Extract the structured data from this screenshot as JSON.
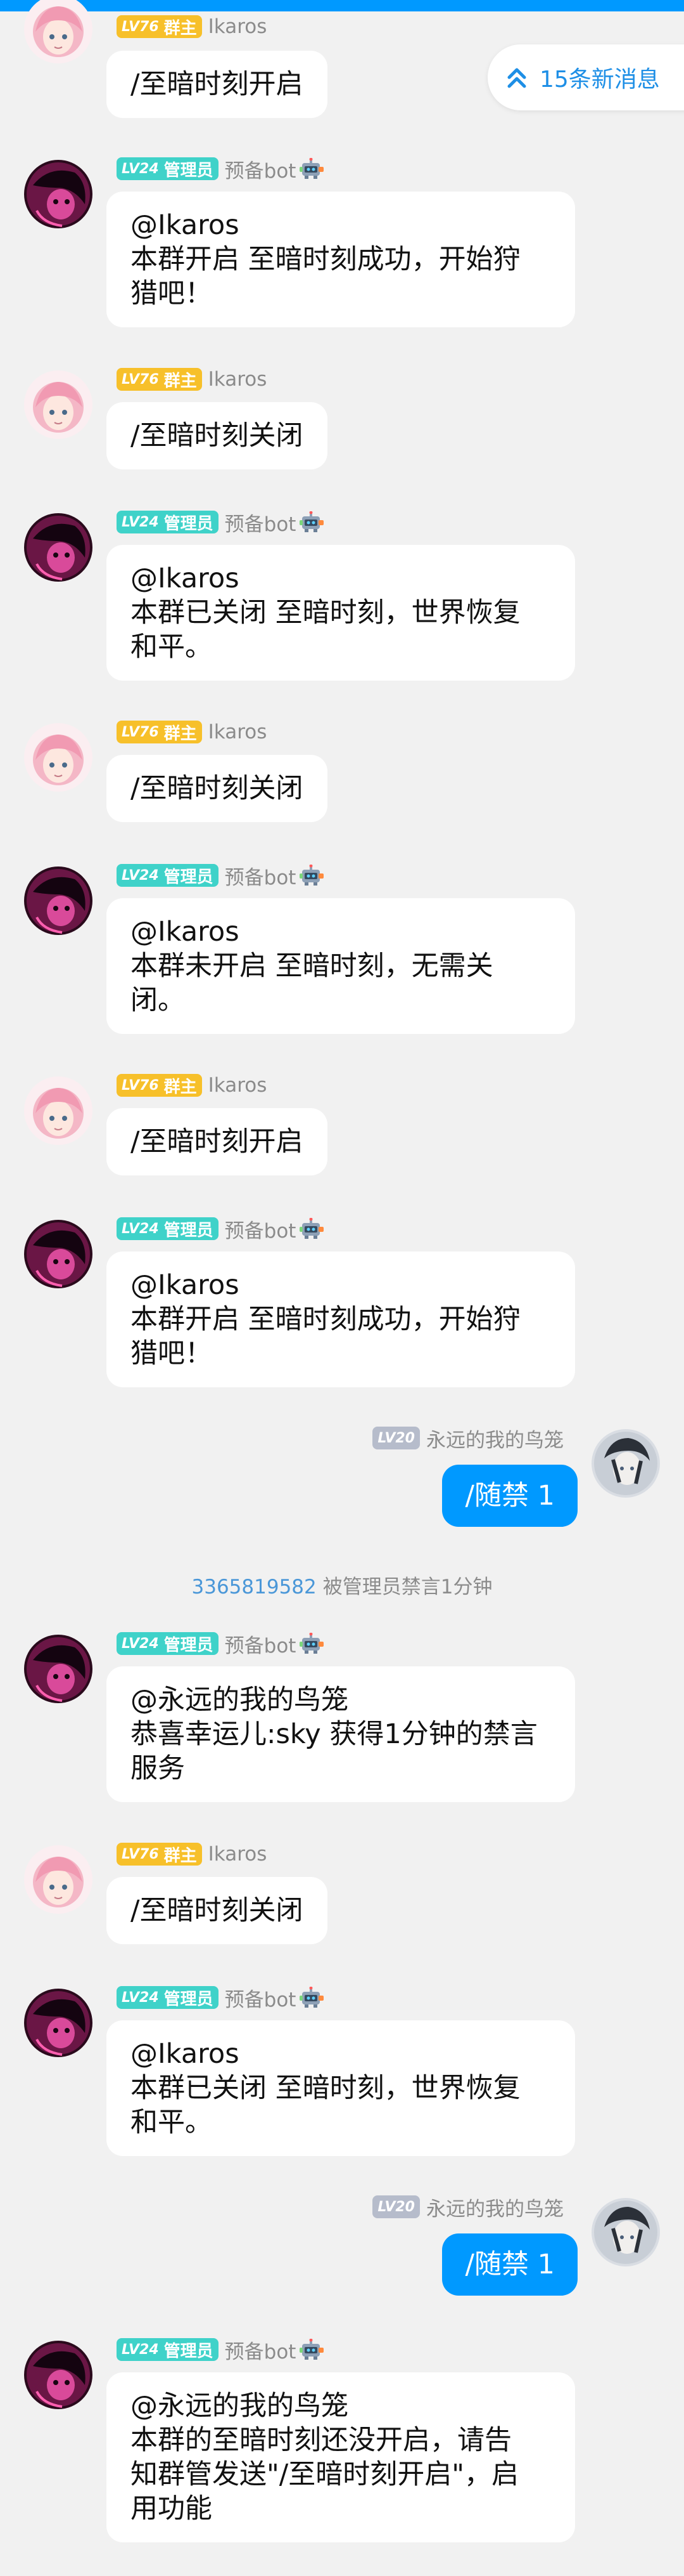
{
  "colors": {
    "accent": "#0099ff",
    "owner_badge": "#f7c02a",
    "admin_badge": "#3fd2c9",
    "member_badge": "#b6bccb",
    "link": "#4a97d8"
  },
  "new_messages": {
    "label": "15条新消息",
    "icon": "double-chevron-up-icon"
  },
  "roles": {
    "owner": {
      "level": "LV76",
      "role": "群主",
      "nick": "Ikaros"
    },
    "admin": {
      "level": "LV24",
      "role": "管理员",
      "nick": "预备bot",
      "icon": "robot-icon"
    },
    "member": {
      "level": "LV20",
      "nick": "永远的我的鸟笼"
    }
  },
  "messages": [
    {
      "lines": [
        "/至暗时刻开启"
      ]
    },
    {
      "lines": [
        "@Ikaros",
        "本群开启 至暗时刻成功，开始狩",
        "猎吧！"
      ]
    },
    {
      "lines": [
        "/至暗时刻关闭"
      ]
    },
    {
      "lines": [
        "@Ikaros",
        "本群已关闭 至暗时刻，世界恢复",
        "和平。"
      ]
    },
    {
      "lines": [
        "/至暗时刻关闭"
      ]
    },
    {
      "lines": [
        "@Ikaros",
        "本群未开启 至暗时刻，无需关",
        "闭。"
      ]
    },
    {
      "lines": [
        "/至暗时刻开启"
      ]
    },
    {
      "lines": [
        "@Ikaros",
        "本群开启 至暗时刻成功，开始狩",
        "猎吧！"
      ]
    },
    {
      "lines": [
        "/随禁 1"
      ]
    },
    {
      "lines": [
        "@永远的我的鸟笼",
        "恭喜幸运儿:sky 获得1分钟的禁言",
        "服务"
      ]
    },
    {
      "lines": [
        "/至暗时刻关闭"
      ]
    },
    {
      "lines": [
        "@Ikaros",
        "本群已关闭 至暗时刻，世界恢复",
        "和平。"
      ]
    },
    {
      "lines": [
        "/随禁 1"
      ]
    },
    {
      "lines": [
        "@永远的我的鸟笼",
        "本群的至暗时刻还没开启，请告",
        "知群管发送\"/至暗时刻开启\"，启",
        "用功能"
      ]
    }
  ],
  "system_notice": {
    "uid": "3365819582",
    "text": "被管理员禁言1分钟"
  }
}
